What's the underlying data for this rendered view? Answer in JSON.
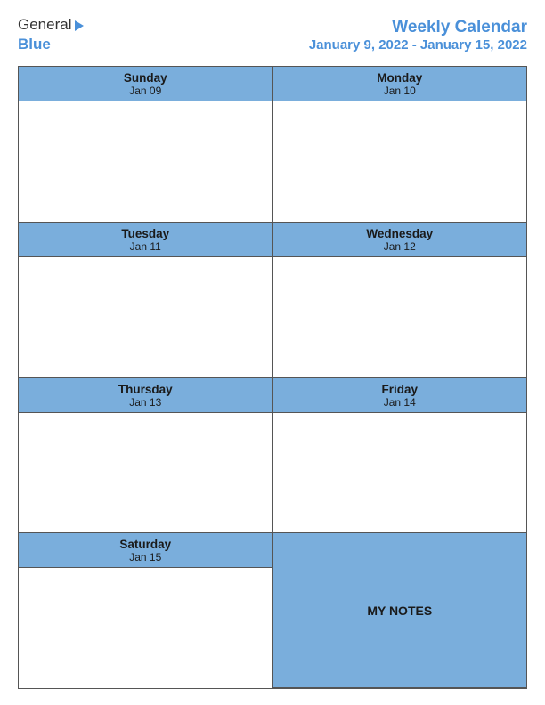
{
  "header": {
    "logo": {
      "general": "General",
      "blue": "Blue"
    },
    "title": "Weekly Calendar",
    "date_range": "January 9, 2022 - January 15, 2022"
  },
  "calendar": {
    "rows": [
      {
        "cells": [
          {
            "day": "Sunday",
            "date": "Jan 09"
          },
          {
            "day": "Monday",
            "date": "Jan 10"
          }
        ]
      },
      {
        "cells": [
          {
            "day": "Tuesday",
            "date": "Jan 11"
          },
          {
            "day": "Wednesday",
            "date": "Jan 12"
          }
        ]
      },
      {
        "cells": [
          {
            "day": "Thursday",
            "date": "Jan 13"
          },
          {
            "day": "Friday",
            "date": "Jan 14"
          }
        ]
      },
      {
        "cells": [
          {
            "day": "Saturday",
            "date": "Jan 15"
          },
          {
            "day": "MY NOTES",
            "date": ""
          }
        ]
      }
    ]
  }
}
